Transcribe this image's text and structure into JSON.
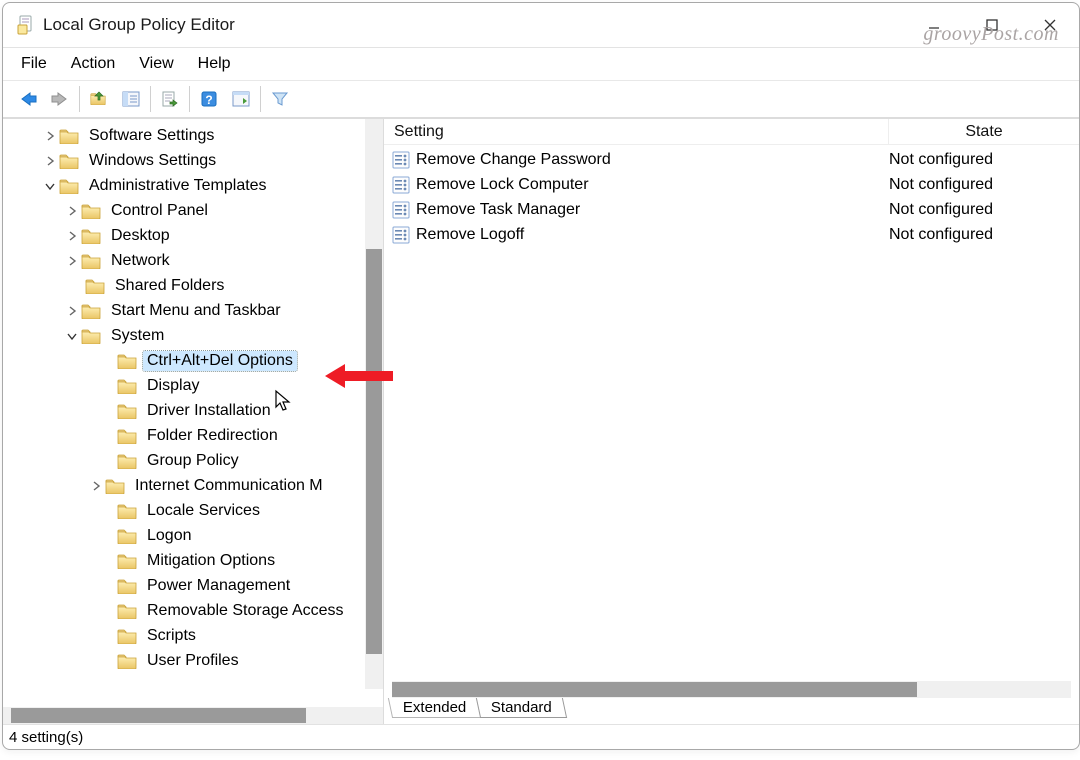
{
  "window": {
    "title": "Local Group Policy Editor"
  },
  "watermark": "groovyPost.com",
  "menu": {
    "file": "File",
    "action": "Action",
    "view": "View",
    "help": "Help"
  },
  "tree": {
    "software_settings": "Software Settings",
    "windows_settings": "Windows Settings",
    "admin_templates": "Administrative Templates",
    "control_panel": "Control Panel",
    "desktop": "Desktop",
    "network": "Network",
    "shared_folders": "Shared Folders",
    "start_menu": "Start Menu and Taskbar",
    "system": "System",
    "ctrl_alt_del": "Ctrl+Alt+Del Options",
    "display": "Display",
    "driver_installation": "Driver Installation",
    "folder_redirection": "Folder Redirection",
    "group_policy": "Group Policy",
    "internet_comm": "Internet Communication M",
    "locale_services": "Locale Services",
    "logon": "Logon",
    "mitigation_options": "Mitigation Options",
    "power_management": "Power Management",
    "removable_storage": "Removable Storage Access",
    "scripts": "Scripts",
    "user_profiles": "User Profiles"
  },
  "list": {
    "header_setting": "Setting",
    "header_state": "State",
    "rows": [
      {
        "name": "Remove Change Password",
        "state": "Not configured"
      },
      {
        "name": "Remove Lock Computer",
        "state": "Not configured"
      },
      {
        "name": "Remove Task Manager",
        "state": "Not configured"
      },
      {
        "name": "Remove Logoff",
        "state": "Not configured"
      }
    ]
  },
  "tabs": {
    "extended": "Extended",
    "standard": "Standard"
  },
  "status": "4 setting(s)"
}
